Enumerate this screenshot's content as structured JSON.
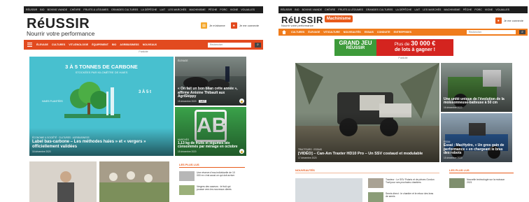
{
  "left": {
    "topbar": [
      "RÉUSSIR",
      "BIO",
      "BOVINS VIANDE",
      "CHÈVRE",
      "FRUITS & LÉGUMES",
      "GRANDES CULTURES",
      "LA DÉPÊCHE",
      "LAIT",
      "LES MARCHÉS",
      "MACHINISME",
      "PÊCHE",
      "PORC",
      "VIGNE",
      "VOLAILLES"
    ],
    "logo": "RéUSSIR",
    "tagline": "Nourrir votre performance",
    "header_actions": [
      "Je m'abonne",
      "Je me connecte"
    ],
    "nav": [
      "Élevage",
      "Cultures",
      "Viti-Œnologie",
      "Équipement",
      "Bio",
      "Agribusiness",
      "Nouveaux"
    ],
    "search_placeholder": "Rechercher",
    "pub_label": "Publicité",
    "hero": {
      "heading": "3 À 5 TONNES DE CARBONE",
      "subheading": "STOCKÉES PAR KILOMÈTRE DE HAIES",
      "gauge_label": "3 À 5 t",
      "tree_label": "HAIES PLANTÉES",
      "category": "ÉCONOMIE & SOCIÉTÉ · CULTURES · AGRIBUSINESS",
      "title": "Label bas-carbone – Les méthodes haies » et « vergers » officiellement validées",
      "date": "16 décembre 2020"
    },
    "card1": {
      "category": "ÉLEVAGE",
      "title": "« On fait un bon bilan cette année », affirme Antoine Thibault aux AgriSkippy",
      "date": "15 décembre 2020",
      "tag": "LAIT"
    },
    "card2": {
      "logo": "AB",
      "category": "MARCHÉS",
      "title": "1,13 kg de fruits et légumes bio consommés par ménage en octobre",
      "date": "15 décembre 2020"
    },
    "les_plus_lus": "LES PLUS LUS",
    "mini_items": [
      "Une réserve d'eau individuelle de 10 000 m³ c'est aussi ce qui doit arriver",
      "Vergers des saveurs : le fruit qui pousse vers les nouveaux clients"
    ]
  },
  "right": {
    "topbar": [
      "RÉUSSIR",
      "BIO",
      "BOVINS VIANDE",
      "CHÈVRE",
      "FRUITS & LÉGUMES",
      "GRANDES CULTURES",
      "LA DÉPÊCHE",
      "LAIT",
      "LES MARCHÉS",
      "MACHINISME",
      "PÊCHE",
      "PORC",
      "VIGNE",
      "VOLAILLES"
    ],
    "logo": "RéUSSIR",
    "logo_badge": "Machinisme",
    "tagline": "Nourrir votre performance",
    "header_actions": [
      "Je me connecte"
    ],
    "nav": [
      "Cultures",
      "Élevage",
      "Viticulture",
      "Nouveautés",
      "Essais",
      "Conduite",
      "Entreprises"
    ],
    "search_placeholder": "Rechercher",
    "banner": {
      "title_top": "GRAND JEU",
      "title_bottom": "RÉUSSIR",
      "line1": "Plus de",
      "amount": "30 000 €",
      "line2": "de lots à gagner !"
    },
    "pub_label": "Publicité",
    "hero": {
      "category": "TRACTEURS · ESSAIS",
      "title": "[VIDÉO] – Can-Am Traxter HD10 Pro – Un SSV costaud et modulable",
      "date": "17 décembre 2020"
    },
    "card1": {
      "title": "Une unité unique de l'évolution de la moissonneuse-batteuse à 50 cm",
      "date": "16 décembre 2020"
    },
    "card2": {
      "category": "Essai",
      "title": "Essai : MacHydro, « Un gros gain de performance » en chargeant le bras des robots",
      "date": "15 décembre 2020"
    },
    "nouveautes": "NOUVEAUTÉS",
    "les_plus_lus": "LES PLUS LUS",
    "mini_items": [
      "Tracteur : Le SSV Polaris et de pièces Gordon Trail pour ses prochains chantiers",
      "Semis direct : le chantier et le retour des bras de semis",
      "Nouvelle technologie sur la moisson 2021"
    ]
  },
  "colors": {
    "accent": "#e85a1a",
    "nav_left": "#e24a1f",
    "nav_right": "#f07c1c",
    "topbar": "#1d1d1d",
    "hero_bg": "#48c0cf",
    "green_card": "#3aa24a",
    "banner_green": "#3d9a3a",
    "banner_red": "#d4241f"
  }
}
